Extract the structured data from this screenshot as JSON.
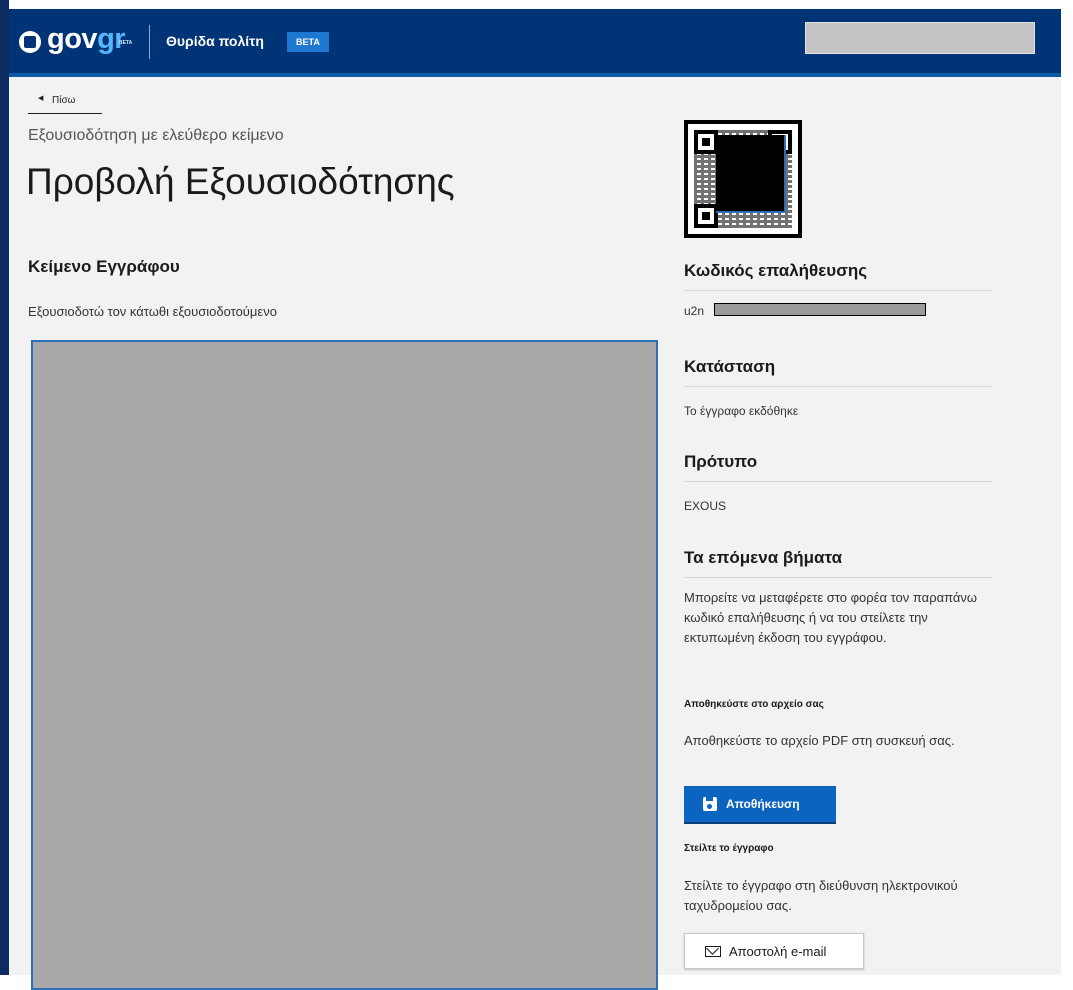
{
  "header": {
    "logo_gov": "gov",
    "logo_gr": "gr",
    "logo_beta": "BETA",
    "title": "Θυρίδα πολίτη",
    "beta_badge": "BETA"
  },
  "nav": {
    "back_label": "Πίσω"
  },
  "page": {
    "caption": "Εξουσιοδότηση με ελεύθερο κείμενο",
    "title": "Προβολή Εξουσιοδότησης",
    "document_heading": "Κείμενο Εγγράφου",
    "document_text": "Εξουσιοδοτώ τον κάτωθι εξουσιοδοτούμενο"
  },
  "sidebar": {
    "verification": {
      "heading": "Κωδικός επαλήθευσης",
      "value_prefix": "u2n"
    },
    "status": {
      "heading": "Κατάσταση",
      "value": "Το έγγραφο εκδόθηκε"
    },
    "template": {
      "heading": "Πρότυπο",
      "value": "EXOUS"
    },
    "next_steps": {
      "heading": "Τα επόμενα βήματα",
      "text": "Μπορείτε να μεταφέρετε στο φορέα τον παραπάνω κωδικό επαλήθευσης ή να του στείλετε την εκτυπωμένη έκδοση του εγγράφου."
    },
    "save": {
      "heading": "Αποθηκεύστε στο αρχείο σας",
      "text": "Αποθηκεύστε το αρχείο PDF στη συσκευή σας.",
      "button": "Αποθήκευση"
    },
    "send": {
      "heading": "Στείλτε το έγγραφο",
      "text": "Στείλτε το έγγραφο στη διεύθυνση ηλεκτρονικού ταχυδρομείου σας.",
      "button": "Αποστολή e-mail"
    }
  },
  "icons": {
    "save": "floppy-disk-icon",
    "email": "envelope-icon",
    "back": "chevron-left-icon"
  },
  "colors": {
    "header_bg": "#003476",
    "accent": "#0b64c0",
    "redaction": "#a8a8a8"
  }
}
